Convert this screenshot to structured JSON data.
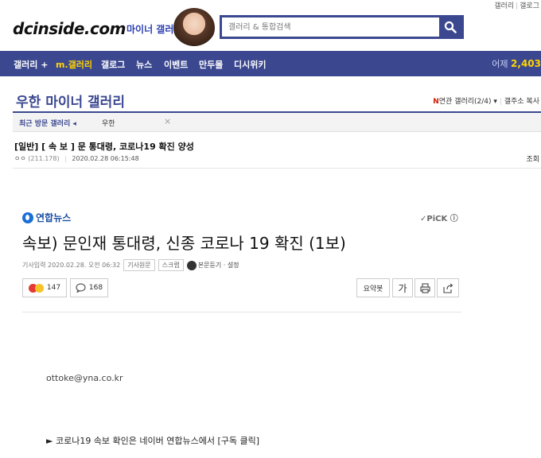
{
  "top_links": [
    "갤러리",
    "갤로그"
  ],
  "header": {
    "logo": "dcinside.com",
    "logo_sub": "마이너 갤러리",
    "search_placeholder": "갤러리 & 통합검색"
  },
  "nav": {
    "items": [
      {
        "label": "갤러리 +",
        "highlight": false
      },
      {
        "label": "m.갤러리",
        "highlight": true
      },
      {
        "label": "갤로그",
        "highlight": false
      },
      {
        "label": "뉴스",
        "highlight": false
      },
      {
        "label": "이벤트",
        "highlight": false
      },
      {
        "label": "만두몰",
        "highlight": false
      },
      {
        "label": "디시위키",
        "highlight": false
      }
    ],
    "yesterday_label": "어제",
    "yesterday_value": "2,403"
  },
  "gallery": {
    "title": "우한 마이너 갤러리",
    "related_prefix": "N",
    "related": "연관 갤러리(2/4) ▾",
    "links_rest": "갤주소 복사"
  },
  "recent": {
    "label": "최근 방문 갤러리 ◂",
    "item": "우한",
    "close": "×"
  },
  "post": {
    "title": "[일반] [ 속 보 ] 문 통대령, 코로나19 확진 양성",
    "author": "ㅇㅇ",
    "ip": "(211.178)",
    "date": "2020.02.28 06:15:48",
    "views_label": "조회"
  },
  "article": {
    "source": "연합뉴스",
    "pick": "✓PiCK ⓘ",
    "headline": "속보) 문인재 통대령, 신종 코로나 19 확진 (1보)",
    "timestamp": "기사입력 2020.02.28. 오전 06:32",
    "tag_original": "기사원문",
    "tag_scrap": "스크랩",
    "audio_label": "본문듣기 · 설정",
    "reaction_count": "147",
    "comment_count": "168",
    "summary_label": "요약봇",
    "font_label": "가",
    "email": "ottoke@yna.co.kr",
    "footer_link": "► 코로나19 속보 확인은 네이버 연합뉴스에서 [구독 클릭]"
  },
  "colors": {
    "brand": "#3b4890",
    "accent": "#ffd400",
    "new_badge": "#d31900"
  }
}
